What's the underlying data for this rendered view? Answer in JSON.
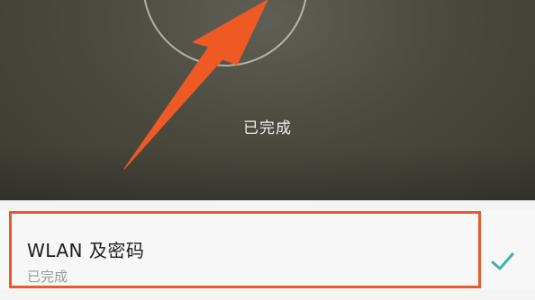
{
  "hero": {
    "status": "已完成"
  },
  "list": {
    "item": {
      "title": "WLAN 及密码",
      "subtitle": "已完成",
      "state_icon": "check-icon"
    }
  },
  "colors": {
    "annotation": "#e85a2c",
    "check": "#3fb0b0"
  }
}
